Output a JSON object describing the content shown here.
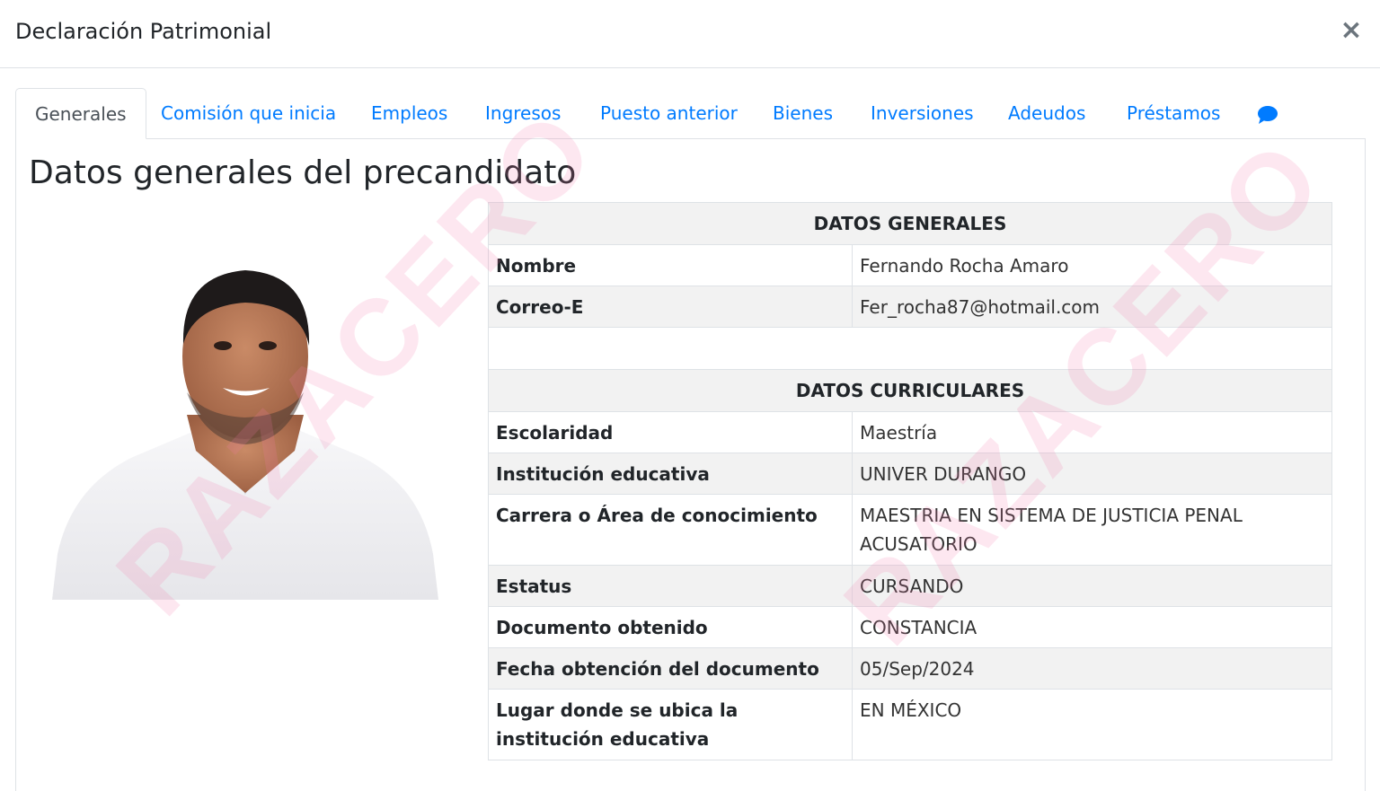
{
  "modal": {
    "title": "Declaración Patrimonial",
    "close_label": "×"
  },
  "tabs": [
    {
      "label": "Generales",
      "active": true
    },
    {
      "label": "Comisión que inicia"
    },
    {
      "label": "Empleos"
    },
    {
      "label": "Ingresos"
    },
    {
      "label": "Puesto anterior"
    },
    {
      "label": "Bienes"
    },
    {
      "label": "Inversiones"
    },
    {
      "label": "Adeudos"
    },
    {
      "label": "Préstamos"
    },
    {
      "icon": "chat-bubble-icon"
    }
  ],
  "section": {
    "title": "Datos generales del precandidato"
  },
  "table": {
    "generales_header": "DATOS GENERALES",
    "nombre_label": "Nombre",
    "nombre_value": "Fernando Rocha Amaro",
    "correo_label": "Correo-E",
    "correo_value": "Fer_rocha87@hotmail.com",
    "curriculares_header": "DATOS CURRICULARES",
    "escolaridad_label": "Escolaridad",
    "escolaridad_value": "Maestría",
    "institucion_label": "Institución educativa",
    "institucion_value": "UNIVER DURANGO",
    "carrera_label": "Carrera o Área de conocimiento",
    "carrera_value": "MAESTRIA EN SISTEMA DE JUSTICIA PENAL ACUSATORIO",
    "estatus_label": "Estatus",
    "estatus_value": "CURSANDO",
    "documento_label": "Documento obtenido",
    "documento_value": "CONSTANCIA",
    "fecha_label": "Fecha obtención del documento",
    "fecha_value": "05/Sep/2024",
    "lugar_label": "Lugar donde se ubica la institución educativa",
    "lugar_value": "EN MÉXICO"
  },
  "watermark": {
    "text": "RAZACERO"
  },
  "colors": {
    "link": "#007bff",
    "border": "#dee2e6",
    "stripe": "#f2f2f2",
    "watermark": "#f578aa"
  }
}
